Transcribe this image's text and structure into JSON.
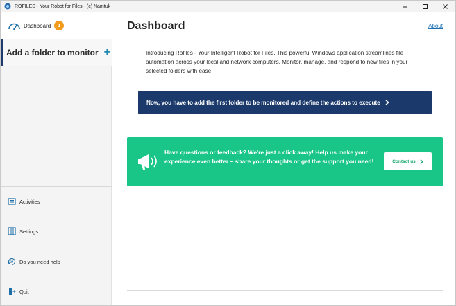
{
  "window": {
    "title": "ROFILES - Your Robot for Files - (c) Namtuk",
    "controls": [
      "minimize-icon",
      "maximize-icon",
      "close-icon"
    ]
  },
  "sidebar": {
    "dashboard": {
      "label": "Dashboard",
      "badge": "1",
      "icon": "gauge-icon"
    },
    "add_folder": {
      "label": "Add a folder to monitor",
      "plus": "+"
    },
    "items": [
      {
        "label": "Activities",
        "icon": "activities-icon"
      },
      {
        "label": "Settings",
        "icon": "settings-icon"
      },
      {
        "label": "Do you need help",
        "icon": "help-24-icon"
      },
      {
        "label": "Quit",
        "icon": "quit-icon"
      }
    ]
  },
  "main": {
    "title": "Dashboard",
    "about": "About",
    "intro": "Introducing Rofiles - Your Intelligent Robot for Files. This powerful Windows application streamlines file automation across your local and network computers. Monitor, manage, and respond to new files in your selected folders with ease.",
    "cta": "Now, you have to add the first folder to be monitored and define the actions to execute",
    "feedback": {
      "text": "Have questions or feedback? We're just a click away! Help us make your experience even better – share your thoughts or get the support you need!",
      "button": "Contact us"
    }
  },
  "colors": {
    "accent_navy": "#1b3a6b",
    "feedback_green": "#19c587",
    "badge_orange": "#f29b1d",
    "link_blue": "#1a6fb5"
  }
}
